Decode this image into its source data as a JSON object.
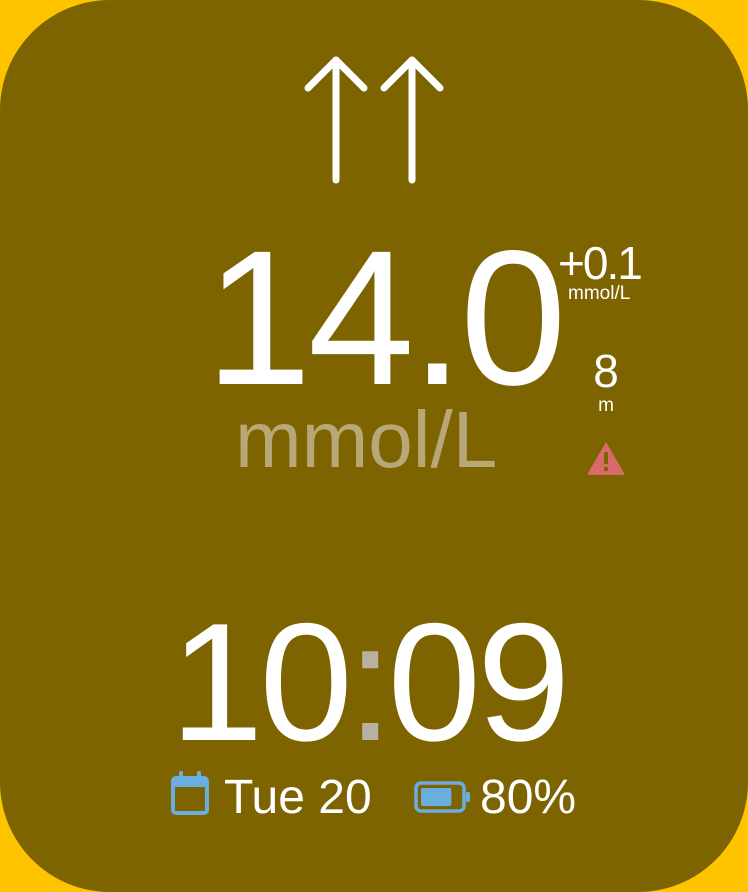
{
  "glucose": {
    "value": "14.0",
    "unit": "mmol/L",
    "trend_icon": "double-up-arrow-icon"
  },
  "delta": {
    "value": "+0.1",
    "unit": "mmol/L"
  },
  "reading_age": {
    "value": "8",
    "unit": "m"
  },
  "alert_icon": "warning-triangle-icon",
  "clock": {
    "hours": "10",
    "separator": ":",
    "minutes": "09"
  },
  "date": {
    "icon": "calendar-icon",
    "text": "Tue 20"
  },
  "battery": {
    "icon": "battery-icon",
    "text": "80%",
    "level": 0.8
  },
  "colors": {
    "outer_background": "#ffc400",
    "screen_background": "#7e6400",
    "primary_text": "#ffffff",
    "unit_text": "#b8a878",
    "warning": "#d86a6a",
    "accent_icon": "#6aaee0"
  }
}
